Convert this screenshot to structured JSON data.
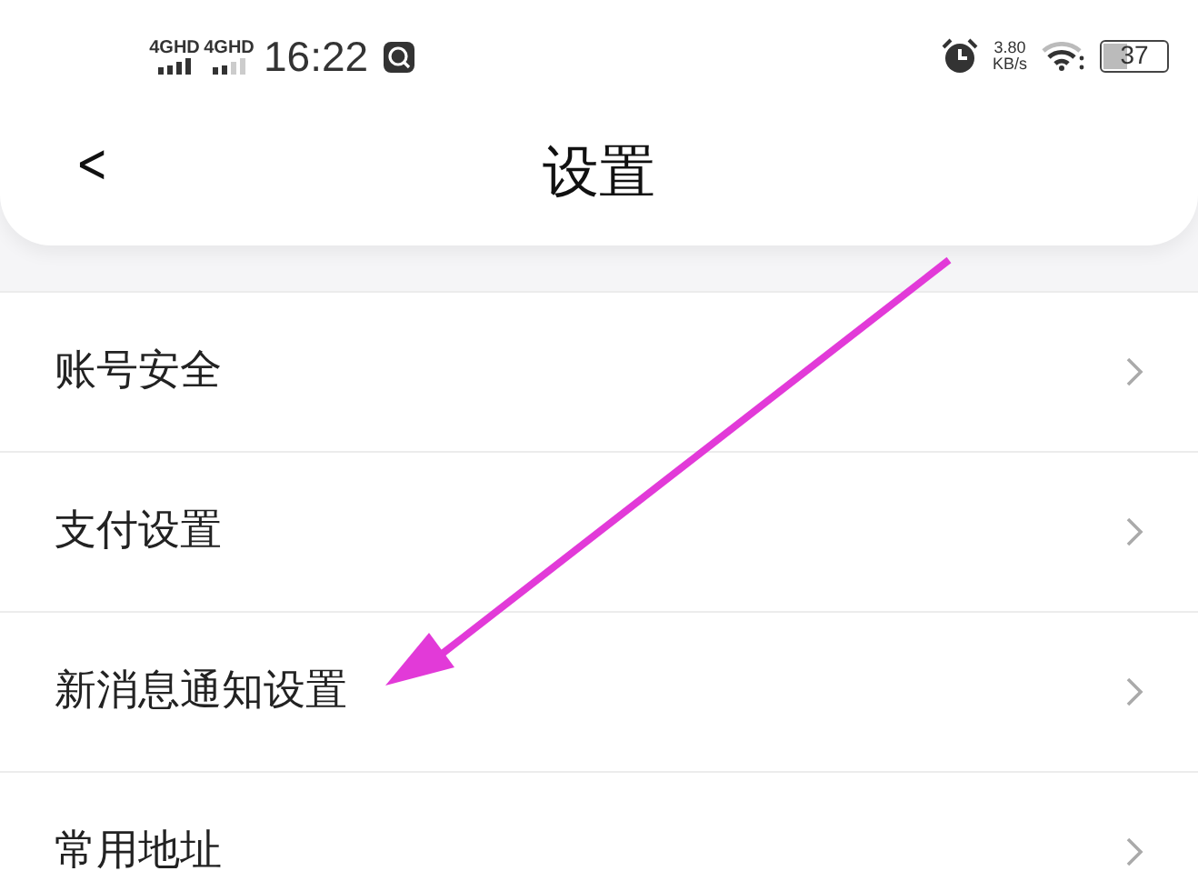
{
  "status_bar": {
    "network_1": "4GHD",
    "network_2": "4GHD",
    "time": "16:22",
    "speed_value": "3.80",
    "speed_unit": "KB/s",
    "battery": "37"
  },
  "header": {
    "back": "<",
    "title": "设置"
  },
  "menu_items": [
    {
      "label": "账号安全"
    },
    {
      "label": "支付设置"
    },
    {
      "label": "新消息通知设置"
    },
    {
      "label": "常用地址"
    }
  ]
}
